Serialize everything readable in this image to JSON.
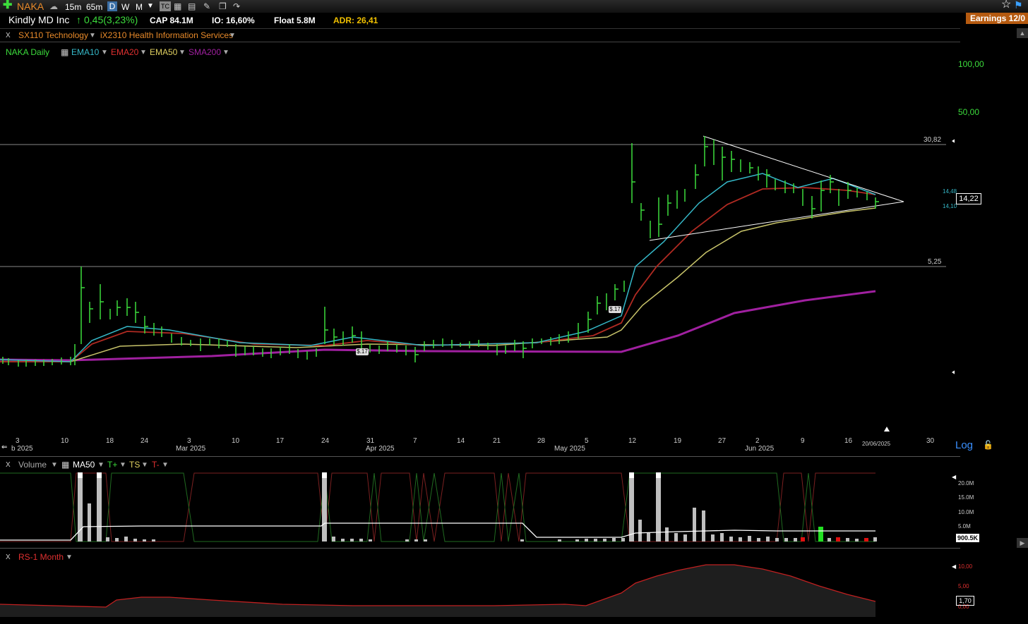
{
  "toolbar": {
    "symbol": "NAKA",
    "interval_15m": "15m",
    "interval_65m": "65m",
    "interval_d": "D",
    "interval_w": "W",
    "interval_m": "M"
  },
  "info": {
    "company": "Kindly MD Inc",
    "change": "0,45(3,23%)",
    "cap": "CAP 84.1M",
    "io": "IO: 16,60%",
    "float": "Float 5.8M",
    "adr": "ADR: 26,41",
    "earnings": "Earnings 12/0"
  },
  "sectors": {
    "close": "X",
    "sector": "SX110 Technology",
    "industry": "iX2310 Health Information Services"
  },
  "legend": {
    "symbol_daily": "NAKA Daily",
    "ema10": "EMA10",
    "ema20": "EMA20",
    "ema50": "EMA50",
    "sma200": "SMA200"
  },
  "price_axis": {
    "p100": "100,00",
    "p50": "50,00",
    "line_high": "30,82",
    "line_low": "5,25",
    "last": "14,22",
    "ema_a": "14,48",
    "ema_b": "14,10"
  },
  "chart_flags": {
    "flag1": "$.17",
    "flag2": "$.17"
  },
  "date_axis": {
    "ticks": [
      {
        "label": "3"
      },
      {
        "label": "10"
      },
      {
        "label": "18"
      },
      {
        "label": "24"
      },
      {
        "label": "3"
      },
      {
        "label": "10"
      },
      {
        "label": "17"
      },
      {
        "label": "24"
      },
      {
        "label": "31"
      },
      {
        "label": "7"
      },
      {
        "label": "14"
      },
      {
        "label": "21"
      },
      {
        "label": "28"
      },
      {
        "label": "5"
      },
      {
        "label": "12"
      },
      {
        "label": "19"
      },
      {
        "label": "27"
      },
      {
        "label": "2"
      },
      {
        "label": "9"
      },
      {
        "label": "16"
      },
      {
        "label": "30"
      }
    ],
    "months": [
      {
        "label": "b 2025"
      },
      {
        "label": "Mar 2025"
      },
      {
        "label": "Apr 2025"
      },
      {
        "label": "May 2025"
      },
      {
        "label": "Jun 2025"
      }
    ],
    "current_date": "20/06/2025",
    "log": "Log"
  },
  "volume_panel": {
    "close": "X",
    "title": "Volume",
    "ma": "MA50",
    "t_plus": "T+",
    "ts": "TS",
    "t_minus": "T-",
    "axis_20m": "20.0M",
    "axis_15m": "15.0M",
    "axis_10m": "10.0M",
    "axis_5m": "5.0M",
    "current": "900.5K"
  },
  "rs_panel": {
    "close": "X",
    "title": "RS-1 Month",
    "axis_10": "10,00",
    "axis_5": "5,00",
    "axis_0": "0,00",
    "current": "1,70"
  },
  "colors": {
    "up_bar": "#3cdc3c",
    "ema10": "#35b8c8",
    "ema20": "#c0281e",
    "ema50": "#c8c46a",
    "sma200": "#a020a0",
    "earnings_bg": "#b55a10"
  },
  "price_series": [
    {
      "d": "2025-02-03",
      "h": 1.75,
      "l": 1.62
    },
    {
      "d": "2025-02-10",
      "h": 1.68,
      "l": 1.55
    },
    {
      "d": "2025-02-14",
      "h": 6.3,
      "l": 2.2
    },
    {
      "d": "2025-02-18",
      "h": 4.6,
      "l": 3.0
    },
    {
      "d": "2025-02-24",
      "h": 4.2,
      "l": 2.6
    },
    {
      "d": "2025-03-03",
      "h": 2.6,
      "l": 2.2
    },
    {
      "d": "2025-03-17",
      "h": 2.0,
      "l": 1.8
    },
    {
      "d": "2025-03-24",
      "h": 4.4,
      "l": 1.9
    },
    {
      "d": "2025-04-01",
      "h": 2.4,
      "l": 1.9
    },
    {
      "d": "2025-04-21",
      "h": 2.2,
      "l": 1.9
    },
    {
      "d": "2025-05-05",
      "h": 3.4,
      "l": 2.8
    },
    {
      "d": "2025-05-12",
      "h": 34.8,
      "l": 11.0
    },
    {
      "d": "2025-05-27",
      "h": 31.0,
      "l": 22.0
    },
    {
      "d": "2025-06-09",
      "h": 16.0,
      "l": 11.0
    },
    {
      "d": "2025-06-20",
      "h": 14.5,
      "l": 13.6
    }
  ]
}
